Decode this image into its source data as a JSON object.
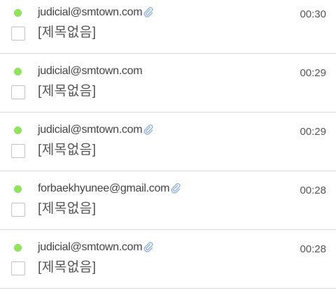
{
  "colors": {
    "unread_dot": "#8ee55b",
    "attachment_icon": "#8fb3df",
    "divider": "#d9d9d9"
  },
  "mails": [
    {
      "sender": "judicial@smtown.com",
      "has_attachment": true,
      "time": "00:30",
      "subject": "[제목없음]",
      "unread": true
    },
    {
      "sender": "judicial@smtown.com",
      "has_attachment": false,
      "time": "00:29",
      "subject": "[제목없음]",
      "unread": true
    },
    {
      "sender": "judicial@smtown.com",
      "has_attachment": true,
      "time": "00:29",
      "subject": "[제목없음]",
      "unread": true
    },
    {
      "sender": "forbaekhyunee@gmail.com",
      "has_attachment": true,
      "time": "00:28",
      "subject": "[제목없음]",
      "unread": true
    },
    {
      "sender": "judicial@smtown.com",
      "has_attachment": true,
      "time": "00:28",
      "subject": "[제목없음]",
      "unread": true
    }
  ],
  "icons": {
    "attachment": "paperclip-icon"
  }
}
